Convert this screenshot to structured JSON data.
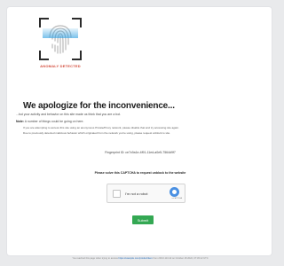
{
  "logo": {
    "text": "ANOMALY DETECTED",
    "icon": "fingerprint-icon"
  },
  "heading": "We apologize for the inconvenience...",
  "intro": "...but your activity and behavior on this site made us think that you are a bot.",
  "note": {
    "label": "Note:",
    "text": "A number of things could be going on here."
  },
  "bullets": [
    "If you are attempting to access this site using an anonymous Private/Proxy network, please disable that and try accessing site again.",
    "Due to previously detected malicious behavior which originated from the network you're using, please request unblock to site."
  ],
  "notice": "Fingerprint ID: ce7c9a1e-4f91-11ed-a0e5-7564d9f7",
  "prompt": "Please solve this CAPTCHA to request unblock to the website",
  "captcha": {
    "label": "I'm not a robot",
    "sub": "reCAPTCHA",
    "logo_color": "#4a90e2"
  },
  "submit_label": "Submit",
  "footer": {
    "before": "You reached this page when trying to access",
    "link": "https://example.com/product/item",
    "after": "from 203.0.113.42 on October 18 2022, 07:45:12 UTC"
  },
  "colors": {
    "accent": "#34a853",
    "alert": "#d24a3a"
  }
}
